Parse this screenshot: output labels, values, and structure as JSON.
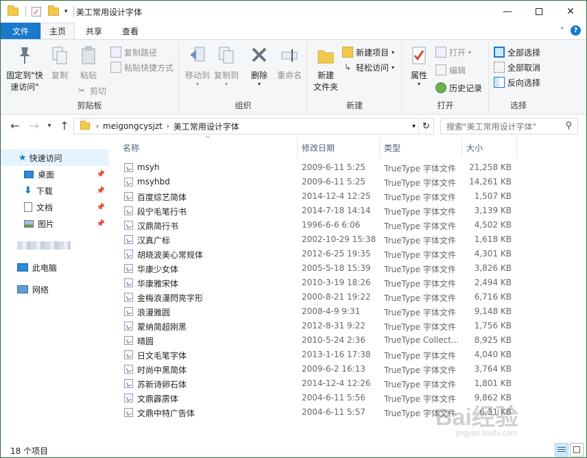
{
  "window": {
    "title": "美工常用设计字体",
    "controls": [
      "minimize",
      "maximize",
      "close"
    ]
  },
  "tabs": {
    "file": "文件",
    "items": [
      "主页",
      "共享",
      "查看"
    ],
    "active": "主页"
  },
  "ribbon": {
    "clipboard": {
      "label": "剪贴板",
      "pin": "固定到\"快\n速访问\"",
      "copy": "复制",
      "paste": "粘贴",
      "copy_path": "复制路径",
      "paste_shortcut": "粘贴快捷方式",
      "cut": "剪切"
    },
    "organize": {
      "label": "组织",
      "move_to": "移动到",
      "copy_to": "复制到",
      "delete": "删除",
      "rename": "重命名"
    },
    "new": {
      "label": "新建",
      "new_folder": "新建\n文件夹",
      "new_item": "新建项目",
      "easy_access": "轻松访问"
    },
    "open": {
      "label": "打开",
      "properties": "属性",
      "open": "打开",
      "edit": "编辑",
      "history": "历史记录"
    },
    "select": {
      "label": "选择",
      "select_all": "全部选择",
      "select_none": "全部取消",
      "invert": "反向选择"
    }
  },
  "address": {
    "crumbs": [
      "meigongcysjzt",
      "美工常用设计字体"
    ],
    "search_placeholder": "搜索\"美工常用设计字体\""
  },
  "nav": {
    "quick_access": "快速访问",
    "items": [
      {
        "label": "桌面",
        "icon": "desktop-icon"
      },
      {
        "label": "下载",
        "icon": "download-icon"
      },
      {
        "label": "文档",
        "icon": "document-icon"
      },
      {
        "label": "图片",
        "icon": "picture-icon"
      }
    ],
    "this_pc": "此电脑",
    "network": "网络"
  },
  "columns": {
    "name": "名称",
    "date": "修改日期",
    "type": "类型",
    "size": "大小"
  },
  "files": [
    {
      "name": "msyh",
      "date": "2009-6-11 5:25",
      "type": "TrueType 字体文件",
      "size": "21,258 KB"
    },
    {
      "name": "msyhbd",
      "date": "2009-6-11 5:25",
      "type": "TrueType 字体文件",
      "size": "14,261 KB"
    },
    {
      "name": "百度综艺简体",
      "date": "2014-12-4 12:25",
      "type": "TrueType 字体文件",
      "size": "1,507 KB"
    },
    {
      "name": "段宁毛笔行书",
      "date": "2014-7-18 14:14",
      "type": "TrueType 字体文件",
      "size": "3,139 KB"
    },
    {
      "name": "汉鼎简行书",
      "date": "1996-6-6 6:06",
      "type": "TrueType 字体文件",
      "size": "4,502 KB"
    },
    {
      "name": "汉真广标",
      "date": "2002-10-29 15:38",
      "type": "TrueType 字体文件",
      "size": "1,618 KB"
    },
    {
      "name": "胡晓波美心常规体",
      "date": "2012-6-25 19:35",
      "type": "TrueType 字体文件",
      "size": "4,301 KB"
    },
    {
      "name": "华康少女体",
      "date": "2005-5-18 15:39",
      "type": "TrueType 字体文件",
      "size": "3,826 KB"
    },
    {
      "name": "华康雅宋体",
      "date": "2010-3-19 18:26",
      "type": "TrueType 字体文件",
      "size": "2,494 KB"
    },
    {
      "name": "金梅浪漫閃亮字形",
      "date": "2000-8-21 19:22",
      "type": "TrueType 字体文件",
      "size": "6,716 KB"
    },
    {
      "name": "浪漫雅圆",
      "date": "2008-4-9 9:31",
      "type": "TrueType 字体文件",
      "size": "9,148 KB"
    },
    {
      "name": "蒙纳简超刚黑",
      "date": "2012-8-31 9:22",
      "type": "TrueType 字体文件",
      "size": "1,756 KB"
    },
    {
      "name": "晴圆",
      "date": "2010-5-24 2:36",
      "type": "TrueType Collect...",
      "size": "8,925 KB"
    },
    {
      "name": "日文毛笔字体",
      "date": "2013-1-16 17:38",
      "type": "TrueType 字体文件",
      "size": "4,040 KB"
    },
    {
      "name": "时尚中黑简体",
      "date": "2009-6-2 16:13",
      "type": "TrueType 字体文件",
      "size": "3,764 KB"
    },
    {
      "name": "苏新诗卵石体",
      "date": "2014-12-4 12:26",
      "type": "TrueType 字体文件",
      "size": "1,801 KB"
    },
    {
      "name": "文鼎霹雳体",
      "date": "2004-6-11 5:56",
      "type": "TrueType 字体文件",
      "size": "9,862 KB"
    },
    {
      "name": "文鼎中特广告体",
      "date": "2004-6-11 5:57",
      "type": "TrueType 字体文件",
      "size": "6,31 KB"
    }
  ],
  "status": {
    "count": "18 个项目"
  },
  "watermark": {
    "brand": "Bai",
    "brand2": "经验",
    "url": "jingyan.baidu.com"
  },
  "colors": {
    "accent": "#1979ca",
    "window_border": "#2b6a3e",
    "ribbon_bg": "#f5f6f7",
    "selection": "#e5f3ff"
  }
}
